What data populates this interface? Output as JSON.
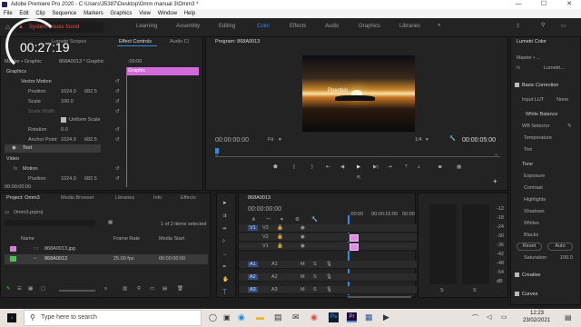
{
  "window": {
    "title": "Adobe Premiere Pro 2020 - C:\\Users\\35387\\Desktop\\Omm manual 3\\Omm3 *",
    "minimize": "—",
    "maximize": "☐",
    "close": "✕"
  },
  "menu": [
    "File",
    "Edit",
    "Clip",
    "Sequence",
    "Markers",
    "Graphics",
    "View",
    "Window",
    "Help"
  ],
  "workspaces": [
    "Learning",
    "Assembly",
    "Editing",
    "Color",
    "Effects",
    "Audio",
    "Graphics",
    "Libraries"
  ],
  "workspace_active": "Color",
  "overlay": {
    "alert": "System issues found",
    "timer": "00:27:19"
  },
  "source_tabs": {
    "scopes": "Lumetri Scopes",
    "effect_controls": "Effect Controls",
    "audio": "Audio Cl"
  },
  "effect_controls": {
    "master": "Master • Graphic",
    "clip": "868A0013 * Graphic",
    "ruler_start": ":00:00",
    "section_graphics": "Graphics",
    "vector_motion": "Vector Motion",
    "position_label": "Position",
    "position_x": "1024.0",
    "position_y": "682.5",
    "scale_label": "Scale",
    "scale_value": "100.0",
    "scale_width_label": "Scale Width",
    "uniform_scale": "Uniform Scale",
    "rotation_label": "Rotation",
    "rotation_value": "0.0",
    "anchor_label": "Anchor Point",
    "anchor_x": "1024.0",
    "anchor_y": "682.5",
    "text_label": "Text",
    "video_section": "Video",
    "motion_label": "Motion",
    "motion_position_label": "Position",
    "motion_position_x": "1024.0",
    "motion_position_y": "682.5",
    "timecode": "00:00:00:00",
    "graphic_clip": "Graphic"
  },
  "program": {
    "title": "Program: 868A0013",
    "overlay_text": "Ppenbin",
    "timecode_left": "00:00:00:00",
    "fit": "Fit",
    "quality": "1/4",
    "timecode_right": "00:00:05:00"
  },
  "lumetri": {
    "title": "Lumetri Color",
    "master": "Master • ...",
    "lumetri_dropdown": "Lumetri...",
    "basic_correction": "Basic Correction",
    "input_lut": "Input LUT",
    "input_lut_value": "None",
    "white_balance": "White Balance",
    "wb_selector": "WB Selector",
    "temperature": "Temperature",
    "tint": "Tint",
    "tone": "Tone",
    "exposure": "Exposure",
    "contrast": "Contrast",
    "highlights": "Highlights",
    "shadows": "Shadows",
    "whites": "Whites",
    "blacks": "Blacks",
    "reset": "Reset",
    "auto": "Auto",
    "saturation": "Saturation",
    "saturation_value": "100.0",
    "creative": "Creative",
    "curves": "Curves"
  },
  "project": {
    "tabs": [
      "Project: Omm3",
      "Media Browser",
      "Libraries",
      "Info",
      "Effects"
    ],
    "file": "Omm3.prproj",
    "items_count": "1 of 2 items selected",
    "col_name": "Name",
    "col_framerate": "Frame Rate",
    "col_mediastart": "Media Start",
    "rows": [
      {
        "name": "868A0013.jpg",
        "fps": "",
        "start": ""
      },
      {
        "name": "868A0013",
        "fps": "25.00 fps",
        "start": "00:00:00:00"
      }
    ]
  },
  "timeline": {
    "title": "868A0013",
    "timecode": "00:00:00:00",
    "ruler_start": ":00:00",
    "ruler_mid": "00:00:15:00",
    "ruler_end": "00:00",
    "video_tracks": [
      "V3",
      "V2",
      "V1"
    ],
    "audio_tracks": [
      "A1",
      "A2",
      "A3"
    ],
    "targets_v": [
      "V1",
      "",
      ""
    ],
    "targets_a": [
      "A1",
      "A2",
      "A3"
    ]
  },
  "meter": {
    "labels": [
      "-12",
      "-18",
      "-24",
      "-30",
      "-36",
      "-42",
      "-48",
      "-54",
      "dB"
    ],
    "bottom": [
      "S",
      "S"
    ]
  },
  "taskbar": {
    "search_placeholder": "Type here to search",
    "time": "12:23",
    "date": "23/02/2021",
    "pr_label": "Pr",
    "ps_label": "Ps"
  }
}
